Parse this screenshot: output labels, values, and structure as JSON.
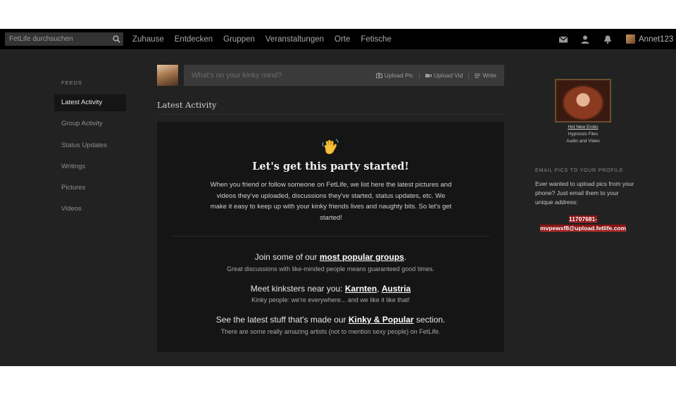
{
  "topbar": {
    "search_placeholder": "FetLife durchsuchen",
    "nav": [
      "Zuhause",
      "Entdecken",
      "Gruppen",
      "Veranstaltungen",
      "Orte",
      "Fetische"
    ],
    "icons": [
      "search-icon",
      "mail-icon",
      "user-icon",
      "bell-icon"
    ],
    "username": "Annet123"
  },
  "sidebar": {
    "heading": "FEEDS",
    "items": [
      "Latest Activity",
      "Group Activity",
      "Status Updates",
      "Writings",
      "Pictures",
      "Videos"
    ],
    "active_index": 0
  },
  "composer": {
    "placeholder": "What's on your kinky mind?",
    "actions": [
      "Upload Pic",
      "Upload Vid",
      "Write"
    ]
  },
  "main": {
    "section_title": "Latest Activity",
    "card": {
      "icon": "waving-hand-icon",
      "heading": "Let's get this party started!",
      "description": "When you friend or follow someone on FetLife, we list here the latest pictures and videos they've uploaded, discussions they've started, status updates, etc. We make it easy to keep up with your kinky friends lives and naughty bits. So let's get started!",
      "groups_prefix": "Join some of our ",
      "groups_link": "most popular groups",
      "groups_suffix": ".",
      "groups_sub": "Great discussions with like-minded people means guaranteed good times.",
      "near_prefix": "Meet kinksters near you: ",
      "near_link_1": "Karnten",
      "near_sep": ", ",
      "near_link_2": "Austria",
      "near_sub": "Kinky people: we're everywhere... and we like it like that!",
      "popular_prefix": "See the latest stuff that's made our ",
      "popular_link": "Kinky & Popular",
      "popular_suffix": " section.",
      "popular_sub": "There are some really amazing artists (not to mention sexy people) on FetLife."
    }
  },
  "right": {
    "promo_link": "Hot New Erotic",
    "promo_line_1": "Hypnosis Files",
    "promo_line_2": "Audio and Video",
    "email_heading": "EMAIL PICS TO YOUR PROFILE",
    "email_desc": "Ever wanted to upload pics from your phone? Just email them to your unique address:",
    "email_line_1": "11707681-",
    "email_line_2": "mvpewxf8@upload.fetlife.com"
  },
  "colors": {
    "background": "#222222",
    "topbar": "#000000",
    "card": "#151515",
    "email_highlight": "#8a1414"
  }
}
